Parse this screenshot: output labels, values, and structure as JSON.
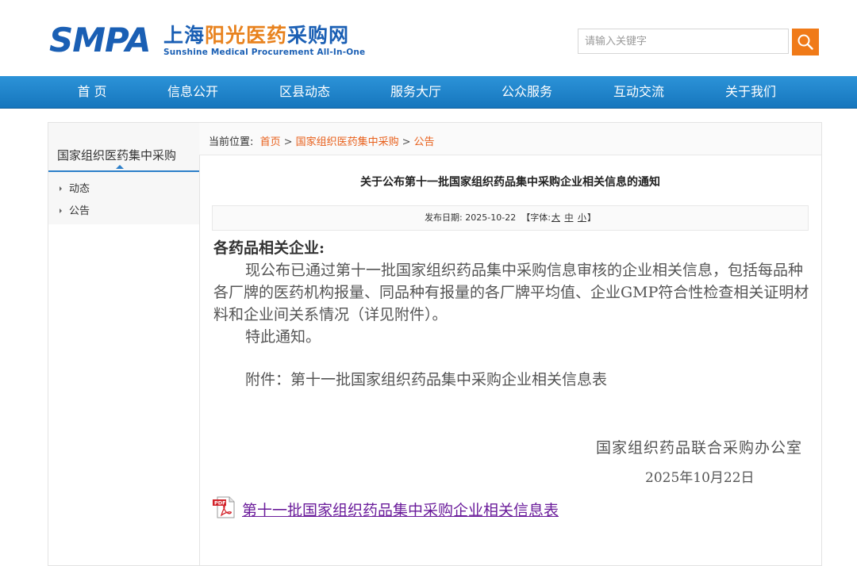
{
  "header": {
    "logo_mark": "SMPA",
    "logo_cn_blue": "上海",
    "logo_cn_orange": "阳光医药",
    "logo_cn_blue2": "采购网",
    "logo_en": "Sunshine Medical Procurement All-In-One",
    "search_placeholder": "请输入关键字"
  },
  "nav": {
    "items": [
      "首 页",
      "信息公开",
      "区县动态",
      "服务大厅",
      "公众服务",
      "互动交流",
      "关于我们"
    ]
  },
  "sidebar": {
    "title": "国家组织医药集中采购",
    "items": [
      "动态",
      "公告"
    ]
  },
  "breadcrumb": {
    "prefix": "当前位置:",
    "items": [
      "首页",
      "国家组织医药集中采购",
      "公告"
    ],
    "separator": ">"
  },
  "article": {
    "title": "关于公布第十一批国家组织药品集中采购企业相关信息的通知",
    "publish_prefix": "发布日期:",
    "publish_date": "2025-10-22",
    "font_prefix": "【字体:",
    "font_large": "大",
    "font_medium": "中",
    "font_small": "小",
    "font_suffix": "】",
    "salutation": "各药品相关企业:",
    "body": "现公布已通过第十一批国家组织药品集中采购信息审核的企业相关信息，包括每品种各厂牌的医药机构报量、同品种有报量的各厂牌平均值、企业GMP符合性检查相关证明材料和企业间关系情况（详见附件）。",
    "notice": "特此通知。",
    "attachment_note": "附件：第十一批国家组织药品集中采购企业相关信息表",
    "signature": "国家组织药品联合采购办公室",
    "sign_date": "2025年10月22日",
    "attachment_link": "第十一批国家组织药品集中采购企业相关信息表"
  },
  "colors": {
    "brand_blue": "#1a5fb4",
    "brand_orange": "#e8821e",
    "nav_blue": "#1676bd",
    "search_button": "#f07a18",
    "link_orange": "#e8601c",
    "attachment_link": "#6a1b9a"
  }
}
